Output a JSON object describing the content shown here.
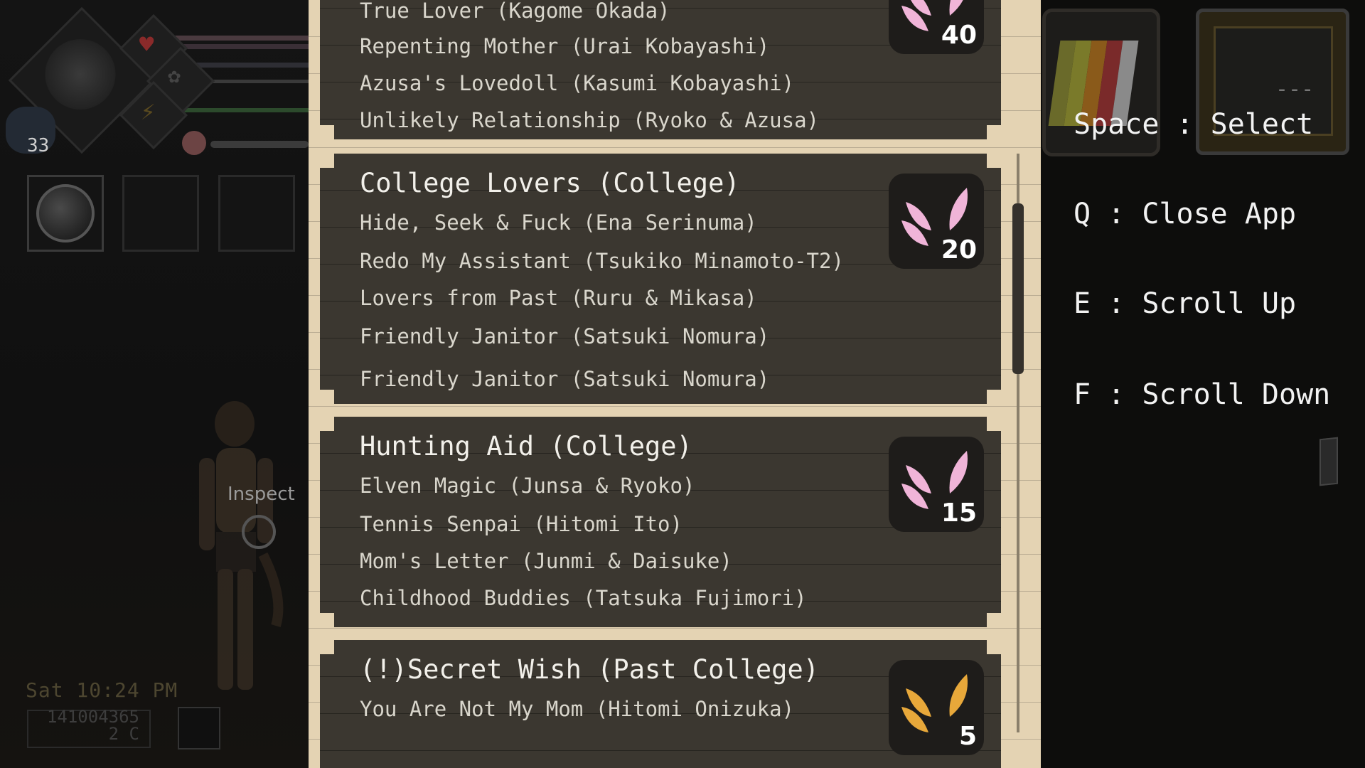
{
  "hud": {
    "level": "33",
    "inspect_label": "Inspect",
    "clock": "Sat 10:24 PM",
    "money": "141004365",
    "currency": "2 C"
  },
  "list": {
    "cards": [
      {
        "title": "",
        "items": [
          "True Lover (Kagome Okada)",
          "Repenting Mother (Urai Kobayashi)",
          "Azusa's Lovedoll (Kasumi Kobayashi)",
          "Unlikely Relationship (Ryoko & Azusa)"
        ],
        "badge_count": "40",
        "badge_color": "#f0b4d8"
      },
      {
        "title": "College Lovers (College)",
        "items": [
          "Hide, Seek & Fuck (Ena Serinuma)",
          "Redo My Assistant (Tsukiko Minamoto-T2)",
          "Lovers from Past (Ruru & Mikasa)",
          "Friendly Janitor (Satsuki Nomura)",
          "Friendly Janitor (Satsuki Nomura)"
        ],
        "badge_count": "20",
        "badge_color": "#f0b4d8"
      },
      {
        "title": "Hunting Aid (College)",
        "items": [
          "Elven Magic (Junsa & Ryoko)",
          "Tennis Senpai (Hitomi Ito)",
          "Mom's Letter (Junmi & Daisuke)",
          "Childhood Buddies (Tatsuka Fujimori)"
        ],
        "badge_count": "15",
        "badge_color": "#f0b4d8"
      },
      {
        "title": "(!)Secret Wish (Past College)",
        "items": [
          "You Are Not My Mom (Hitomi Onizuka)"
        ],
        "badge_count": "5",
        "badge_color": "#e8a83a"
      }
    ]
  },
  "controls": {
    "select": "Space : Select",
    "close": "Q : Close App",
    "scroll_up": "E : Scroll Up",
    "scroll_down": "F : Scroll Down",
    "phone_screen": "---"
  }
}
